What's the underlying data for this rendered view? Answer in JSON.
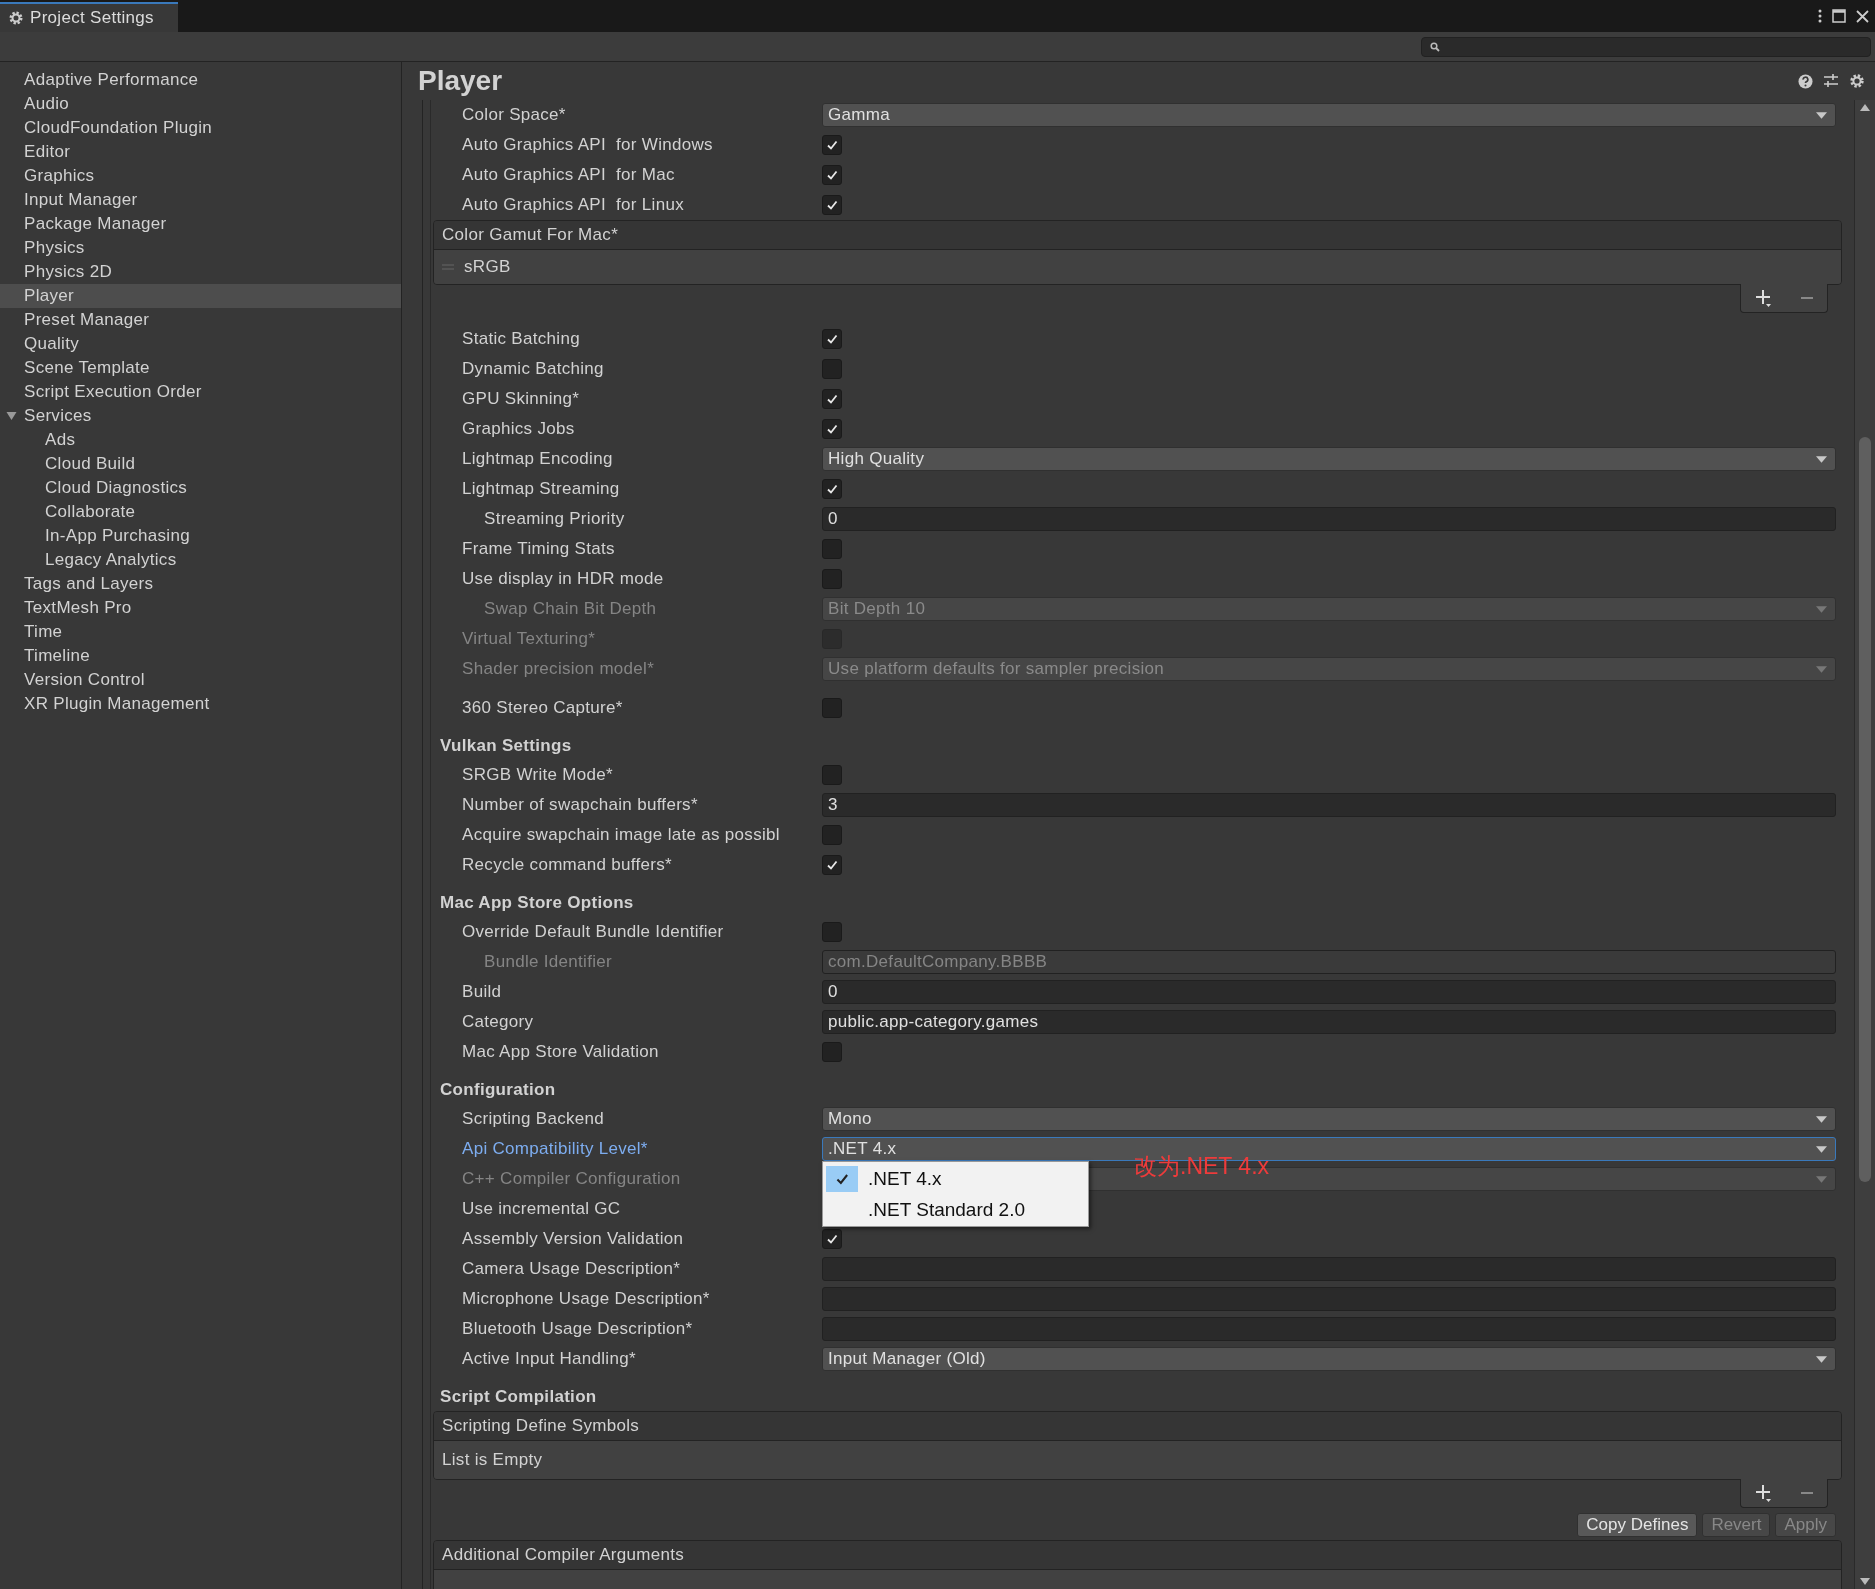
{
  "window": {
    "title": "Project Settings"
  },
  "sidebar": {
    "items": [
      {
        "label": "Adaptive Performance",
        "selected": false
      },
      {
        "label": "Audio",
        "selected": false
      },
      {
        "label": "CloudFoundation Plugin",
        "selected": false
      },
      {
        "label": "Editor",
        "selected": false
      },
      {
        "label": "Graphics",
        "selected": false
      },
      {
        "label": "Input Manager",
        "selected": false
      },
      {
        "label": "Package Manager",
        "selected": false
      },
      {
        "label": "Physics",
        "selected": false
      },
      {
        "label": "Physics 2D",
        "selected": false
      },
      {
        "label": "Player",
        "selected": true
      },
      {
        "label": "Preset Manager",
        "selected": false
      },
      {
        "label": "Quality",
        "selected": false
      },
      {
        "label": "Scene Template",
        "selected": false
      },
      {
        "label": "Script Execution Order",
        "selected": false
      },
      {
        "label": "Services",
        "selected": false,
        "expanded": true,
        "children": [
          {
            "label": "Ads",
            "selected": false
          },
          {
            "label": "Cloud Build",
            "selected": false
          },
          {
            "label": "Cloud Diagnostics",
            "selected": false
          },
          {
            "label": "Collaborate",
            "selected": false
          },
          {
            "label": "In-App Purchasing",
            "selected": false
          },
          {
            "label": "Legacy Analytics",
            "selected": false
          }
        ]
      },
      {
        "label": "Tags and Layers",
        "selected": false
      },
      {
        "label": "TextMesh Pro",
        "selected": false
      },
      {
        "label": "Time",
        "selected": false
      },
      {
        "label": "Timeline",
        "selected": false
      },
      {
        "label": "Version Control",
        "selected": false
      },
      {
        "label": "XR Plugin Management",
        "selected": false
      }
    ]
  },
  "panel": {
    "title": "Player",
    "groups": [
      {
        "rows": [
          {
            "kind": "dropdown",
            "label": "Color Space*",
            "value": "Gamma"
          },
          {
            "kind": "checkbox",
            "label": "Auto Graphics API  for Windows",
            "checked": true
          },
          {
            "kind": "checkbox",
            "label": "Auto Graphics API  for Mac",
            "checked": true
          },
          {
            "kind": "checkbox",
            "label": "Auto Graphics API  for Linux",
            "checked": true
          },
          {
            "kind": "list",
            "header": "Color Gamut For Mac*",
            "items": [
              "sRGB"
            ],
            "footer": true
          }
        ]
      },
      {
        "rows": [
          {
            "kind": "checkbox",
            "label": "Static Batching",
            "checked": true
          },
          {
            "kind": "checkbox",
            "label": "Dynamic Batching",
            "checked": false
          },
          {
            "kind": "checkbox",
            "label": "GPU Skinning*",
            "checked": true
          },
          {
            "kind": "checkbox",
            "label": "Graphics Jobs",
            "checked": true
          },
          {
            "kind": "dropdown",
            "label": "Lightmap Encoding",
            "value": "High Quality"
          },
          {
            "kind": "checkbox",
            "label": "Lightmap Streaming",
            "checked": true
          },
          {
            "kind": "field",
            "label": "Streaming Priority",
            "value": "0",
            "indented": true
          },
          {
            "kind": "checkbox",
            "label": "Frame Timing Stats",
            "checked": false
          },
          {
            "kind": "checkbox",
            "label": "Use display in HDR mode",
            "checked": false
          },
          {
            "kind": "dropdown",
            "label": "Swap Chain Bit Depth",
            "value": "Bit Depth 10",
            "indented": true,
            "disabled": true
          },
          {
            "kind": "checkbox",
            "label": "Virtual Texturing*",
            "checked": false,
            "disabled": true
          },
          {
            "kind": "dropdown",
            "label": "Shader precision model*",
            "value": "Use platform defaults for sampler precision",
            "disabled": true
          }
        ]
      },
      {
        "rows": [
          {
            "kind": "checkbox",
            "label": "360 Stereo Capture*",
            "checked": false
          }
        ]
      },
      {
        "heading": "Vulkan Settings",
        "rows": [
          {
            "kind": "checkbox",
            "label": "SRGB Write Mode*",
            "checked": false
          },
          {
            "kind": "field",
            "label": "Number of swapchain buffers*",
            "value": "3"
          },
          {
            "kind": "checkbox",
            "label": "Acquire swapchain image late as possibl",
            "checked": false
          },
          {
            "kind": "checkbox",
            "label": "Recycle command buffers*",
            "checked": true
          }
        ]
      },
      {
        "heading": "Mac App Store Options",
        "rows": [
          {
            "kind": "checkbox",
            "label": "Override Default Bundle Identifier",
            "checked": false
          },
          {
            "kind": "field",
            "label": "Bundle Identifier",
            "value": "com.DefaultCompany.BBBB",
            "indented": true,
            "disabled": true
          },
          {
            "kind": "field",
            "label": "Build",
            "value": "0"
          },
          {
            "kind": "field",
            "label": "Category",
            "value": "public.app-category.games"
          },
          {
            "kind": "checkbox",
            "label": "Mac App Store Validation",
            "checked": false
          }
        ]
      },
      {
        "heading": "Configuration",
        "rows": [
          {
            "kind": "dropdown",
            "label": "Scripting Backend",
            "value": "Mono"
          },
          {
            "kind": "dropdown",
            "label": "Api Compatibility Level*",
            "value": ".NET 4.x",
            "focused": true,
            "popup": [
              {
                "label": ".NET 4.x",
                "selected": true
              },
              {
                "label": ".NET Standard 2.0",
                "selected": false
              }
            ],
            "annotation": "改为.NET 4.x"
          },
          {
            "kind": "dropdown",
            "label": "C++ Compiler Configuration",
            "disabled": true
          },
          {
            "kind": "label",
            "label": "Use incremental GC"
          },
          {
            "kind": "checkbox",
            "label": "Assembly Version Validation",
            "checked": true
          },
          {
            "kind": "field",
            "label": "Camera Usage Description*"
          },
          {
            "kind": "field",
            "label": "Microphone Usage Description*"
          },
          {
            "kind": "field",
            "label": "Bluetooth Usage Description*"
          },
          {
            "kind": "dropdown",
            "label": "Active Input Handling*",
            "value": "Input Manager (Old)"
          }
        ]
      },
      {
        "heading": "Script Compilation",
        "rows": [
          {
            "kind": "list",
            "header": "Scripting Define Symbols",
            "empty_text": "List is Empty",
            "footer": true
          },
          {
            "kind": "buttons",
            "buttons": [
              {
                "label": "Copy Defines",
                "disabled": false
              },
              {
                "label": "Revert",
                "disabled": true
              },
              {
                "label": "Apply",
                "disabled": true
              }
            ]
          },
          {
            "kind": "list",
            "header": "Additional Compiler Arguments"
          }
        ]
      }
    ]
  }
}
